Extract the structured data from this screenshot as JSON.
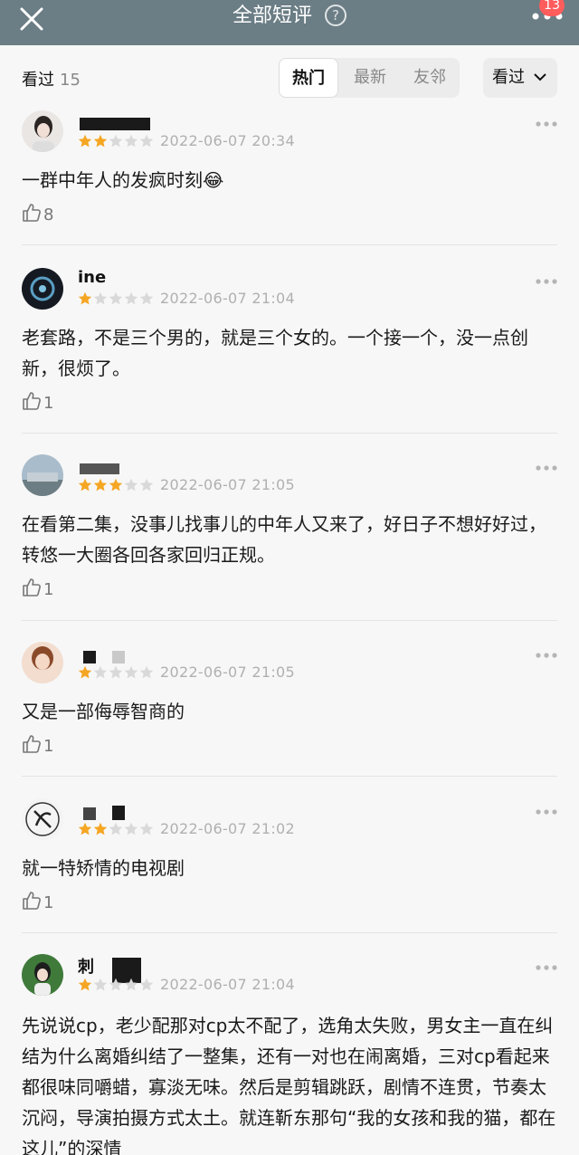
{
  "header": {
    "title": "全部短评",
    "help_label": "?",
    "notification_count": "13"
  },
  "subbar": {
    "seen_label": "看过",
    "seen_count": "15",
    "tabs": [
      {
        "label": "热门"
      },
      {
        "label": "最新"
      },
      {
        "label": "友邻"
      }
    ],
    "filter_label": "看过"
  },
  "colors": {
    "header_bg": "#6b7d85",
    "star_filled": "#f5a623",
    "star_empty": "#d9d9d9",
    "badge": "#ff5c5c"
  },
  "comments": [
    {
      "username": "",
      "rating": 2,
      "time": "2022-06-07 20:34",
      "text": "一群中年人的发疯时刻😂",
      "likes": "8"
    },
    {
      "username": "ine",
      "rating": 1,
      "time": "2022-06-07 21:04",
      "text": "老套路，不是三个男的，就是三个女的。一个接一个，没一点创新，很烦了。",
      "likes": "1"
    },
    {
      "username": "",
      "rating": 3,
      "time": "2022-06-07 21:05",
      "text": "在看第二集，没事儿找事儿的中年人又来了，好日子不想好好过，转悠一大圈各回各家回归正规。",
      "likes": "1"
    },
    {
      "username": "",
      "rating": 1,
      "time": "2022-06-07 21:05",
      "text": "又是一部侮辱智商的",
      "likes": "1"
    },
    {
      "username": "",
      "rating": 2,
      "time": "2022-06-07 21:02",
      "text": "就一特矫情的电视剧",
      "likes": "1"
    },
    {
      "username": "刺",
      "rating": 1,
      "time": "2022-06-07 21:04",
      "text": "先说说cp，老少配那对cp太不配了，选角太失败，男女主一直在纠结为什么离婚纠结了一整集，还有一对也在闹离婚，三对cp看起来都很味同嚼蜡，寡淡无味。然后是剪辑跳跃，剧情不连贯，节奏太沉闷，导演拍摄方式太土。就连靳东那句“我的女孩和我的猫，都在这儿”的深情",
      "likes": ""
    }
  ]
}
